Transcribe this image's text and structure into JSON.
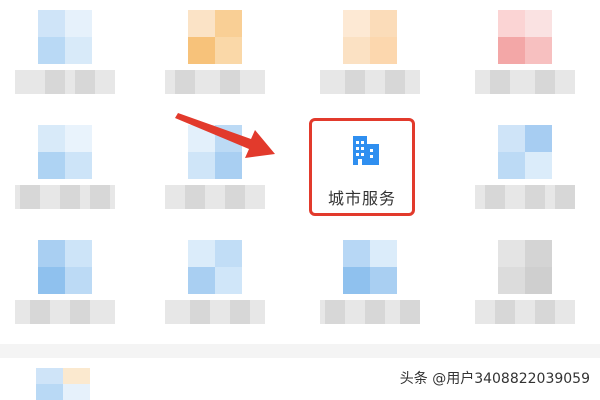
{
  "highlighted_item": {
    "label": "城市服务",
    "icon": "building-icon",
    "icon_color": "#2f8ff0",
    "highlight_color": "#e23a2c"
  },
  "annotation": {
    "icon": "arrow-pointer-icon",
    "color": "#e23a2c"
  },
  "watermark": {
    "text": "头条 @用户3408822039059"
  }
}
